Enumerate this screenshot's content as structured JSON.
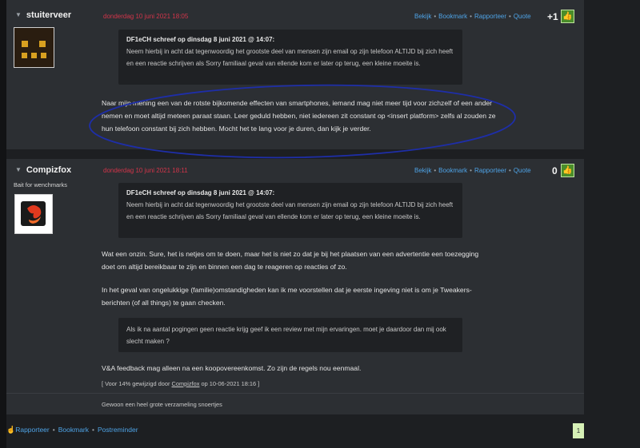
{
  "colors": {
    "accent": "#4ea3e6",
    "date": "#d2354a",
    "vote": "#4a8d2a",
    "bg": "#1d1f22",
    "panel": "#2c2f33"
  },
  "posts": [
    {
      "username": "stuiterveer",
      "date": "donderdag 10 juni 2021 18:05",
      "actions": [
        "Bekijk",
        "Bookmark",
        "Rapporteer",
        "Quote"
      ],
      "score": "+1",
      "quote": {
        "header": "DF1eCH schreef op dinsdag 8 juni 2021 @ 14:07:",
        "text": "Neem hierbij in acht dat tegenwoordig het grootste deel van mensen zijn email op zijn telefoon ALTIJD bij zich heeft en een reactie schrijven als Sorry familiaal geval van ellende kom er later op terug, een kleine moeite is."
      },
      "body": "Naar mijn mening een van de rotste bijkomende effecten van smartphones, iemand mag niet meer tijd voor zichzelf of een ander nemen en moet altijd meteen paraat staan. Leer geduld hebben, niet iedereen zit constant op <insert platform> zelfs al zouden ze hun telefoon constant bij zich hebben. Mocht het te lang voor je duren, dan kijk je verder."
    },
    {
      "username": "Compizfox",
      "subtitle": "Bait for wenchmarks",
      "date": "donderdag 10 juni 2021 18:11",
      "actions": [
        "Bekijk",
        "Bookmark",
        "Rapporteer",
        "Quote"
      ],
      "score": "0",
      "quote": {
        "header": "DF1eCH schreef op dinsdag 8 juni 2021 @ 14:07:",
        "text": "Neem hierbij in acht dat tegenwoordig het grootste deel van mensen zijn email op zijn telefoon ALTIJD bij zich heeft en een reactie schrijven als Sorry familiaal geval van ellende kom er later op terug, een kleine moeite is."
      },
      "para1": "Wat een onzin. Sure, het is netjes om te doen, maar het is niet zo dat je bij het plaatsen van een advertentie een toezegging doet om altijd bereikbaar te zijn en binnen een dag te reageren op reacties of zo.",
      "para2": "In het geval van ongelukkige (familie)omstandigheden kan ik me voorstellen dat je eerste ingeving niet is om je Tweakers-berichten (of all things) te gaan checken.",
      "quote2": "Als ik na aantal pogingen geen reactie krijg geef ik een review met mijn ervaringen. moet je daardoor dan mij ook slecht maken ?",
      "para3": "V&A feedback mag alleen na een koopovereenkomst. Zo zijn de regels nou eenmaal.",
      "edit_prefix": "[ Voor 14% gewijzigd door ",
      "edit_user": "Compizfox",
      "edit_suffix": " op 10-06-2021 18:16 ]",
      "signature": "Gewoon een heel grote verzameling snoertjes"
    }
  ],
  "footer": {
    "actions": [
      "Rapporteer",
      "Bookmark",
      "Postreminder"
    ],
    "page": "1"
  }
}
